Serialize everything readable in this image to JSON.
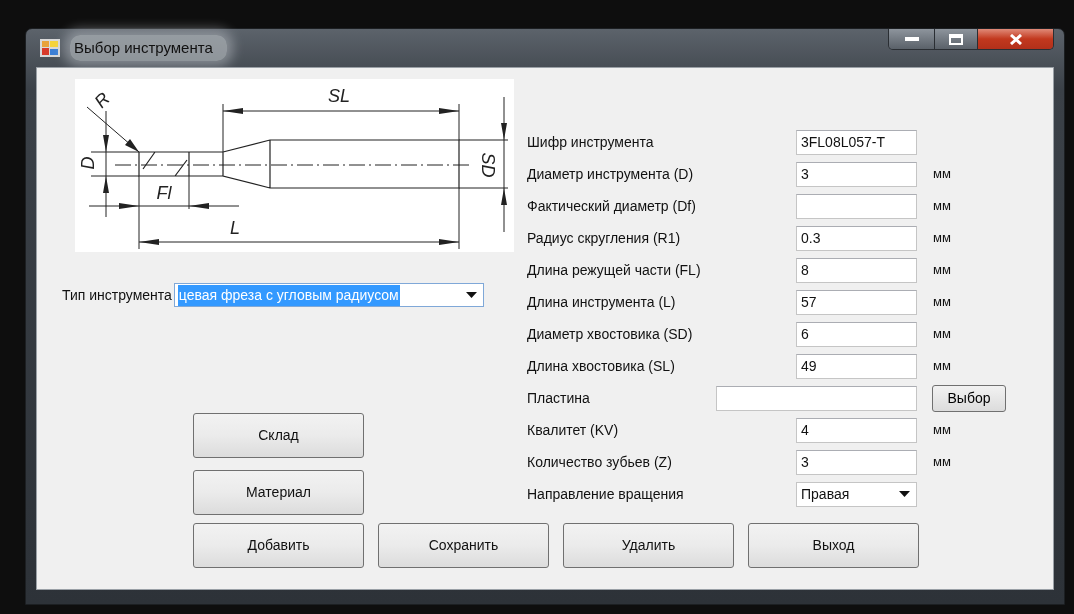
{
  "window": {
    "title": "Выбор инструмента"
  },
  "drawing": {
    "labels": [
      {
        "kind": "R",
        "text": "R"
      },
      {
        "kind": "SL",
        "text": "SL"
      },
      {
        "kind": "D",
        "text": "D"
      },
      {
        "kind": "Fl",
        "text": "Fl"
      },
      {
        "kind": "SD",
        "text": "SD"
      },
      {
        "kind": "L",
        "text": "L"
      }
    ]
  },
  "tool_type": {
    "label": "Тип инструмента",
    "value": "цевая фреза с угловым радиусом",
    "text_selected": true
  },
  "side_buttons": [
    "Склад",
    "Материал"
  ],
  "fields": [
    {
      "kind": "text",
      "label": "Шифр инструмента",
      "value": "3FL08L057-T"
    },
    {
      "kind": "text",
      "label": "Диаметр инструмента (D)",
      "value": "3",
      "unit": "мм"
    },
    {
      "kind": "text",
      "label": "Фактический диаметр (Df)",
      "unit": "мм"
    },
    {
      "kind": "text",
      "label": "Радиус скругления (R1)",
      "value": "0.3",
      "unit": "мм"
    },
    {
      "kind": "text",
      "label": "Длина режущей части (FL)",
      "value": "8",
      "unit": "мм"
    },
    {
      "kind": "text",
      "label": "Длина инструмента (L)",
      "value": "57",
      "unit": "мм"
    },
    {
      "kind": "text",
      "label": "Диаметр хвостовика (SD)",
      "value": "6",
      "unit": "мм"
    },
    {
      "kind": "text",
      "label": "Длина хвостовика (SL)",
      "value": "49",
      "unit": "мм"
    },
    {
      "kind": "picker",
      "label": "Пластина",
      "button": "Выбор"
    },
    {
      "kind": "text",
      "label": "Квалитет (KV)",
      "value": "4",
      "unit": "мм"
    },
    {
      "kind": "text",
      "label": "Количество зубьев (Z)",
      "value": "3",
      "unit": "мм"
    },
    {
      "kind": "dropdown",
      "label": "Направление вращения",
      "value": "Правая"
    }
  ],
  "bottom_buttons": [
    "Добавить",
    "Сохранить",
    "Удалить",
    "Выход"
  ]
}
